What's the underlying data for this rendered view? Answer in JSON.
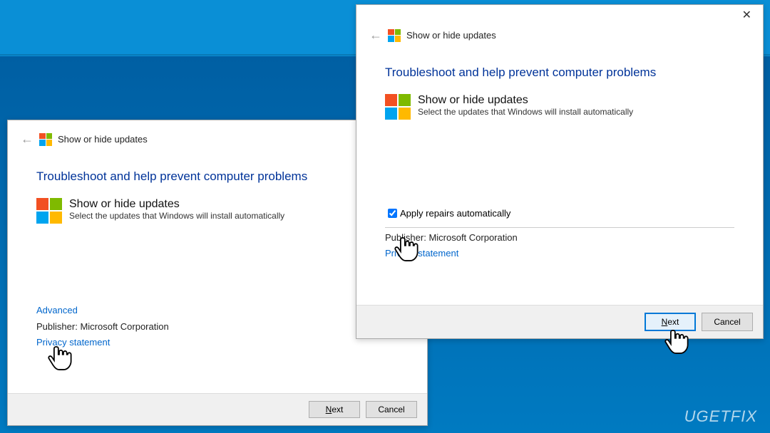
{
  "window1": {
    "title": "Show or hide updates",
    "heading": "Troubleshoot and help prevent computer problems",
    "sub_title": "Show or hide updates",
    "sub_desc": "Select the updates that Windows will install automatically",
    "advanced": "Advanced",
    "publisher_label": "Publisher:",
    "publisher_value": "Microsoft Corporation",
    "privacy": "Privacy statement",
    "next": "Next",
    "cancel": "Cancel"
  },
  "window2": {
    "title": "Show or hide updates",
    "heading": "Troubleshoot and help prevent computer problems",
    "sub_title": "Show or hide updates",
    "sub_desc": "Select the updates that Windows will install automatically",
    "apply_repairs": "Apply repairs automatically",
    "publisher_label": "Publisher:",
    "publisher_value": "Microsoft Corporation",
    "privacy": "Privacy statement",
    "next": "Next",
    "cancel": "Cancel"
  },
  "watermark": "UGETFIX"
}
